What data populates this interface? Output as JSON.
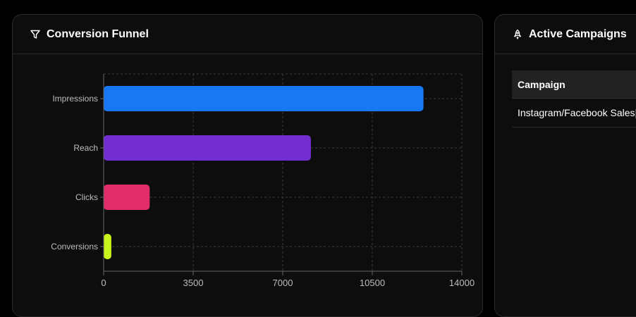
{
  "funnel_card": {
    "title": "Conversion Funnel",
    "icon": "filter-icon"
  },
  "campaigns_card": {
    "title": "Active Campaigns",
    "icon": "rocket-icon",
    "table": {
      "header": "Campaign",
      "rows": [
        "Instagram/Facebook Sales|"
      ]
    }
  },
  "chart_data": {
    "type": "bar",
    "orientation": "horizontal",
    "categories": [
      "Impressions",
      "Reach",
      "Clicks",
      "Conversions"
    ],
    "values": [
      12500,
      8100,
      1800,
      300
    ],
    "colors": [
      "#1877f2",
      "#722ed1",
      "#e12d6a",
      "#c8f31d"
    ],
    "xlim": [
      0,
      14000
    ],
    "xticks": [
      "0",
      "3500",
      "7000",
      "10500",
      "14000"
    ],
    "grid": true,
    "title": "",
    "xlabel": "",
    "ylabel": ""
  }
}
